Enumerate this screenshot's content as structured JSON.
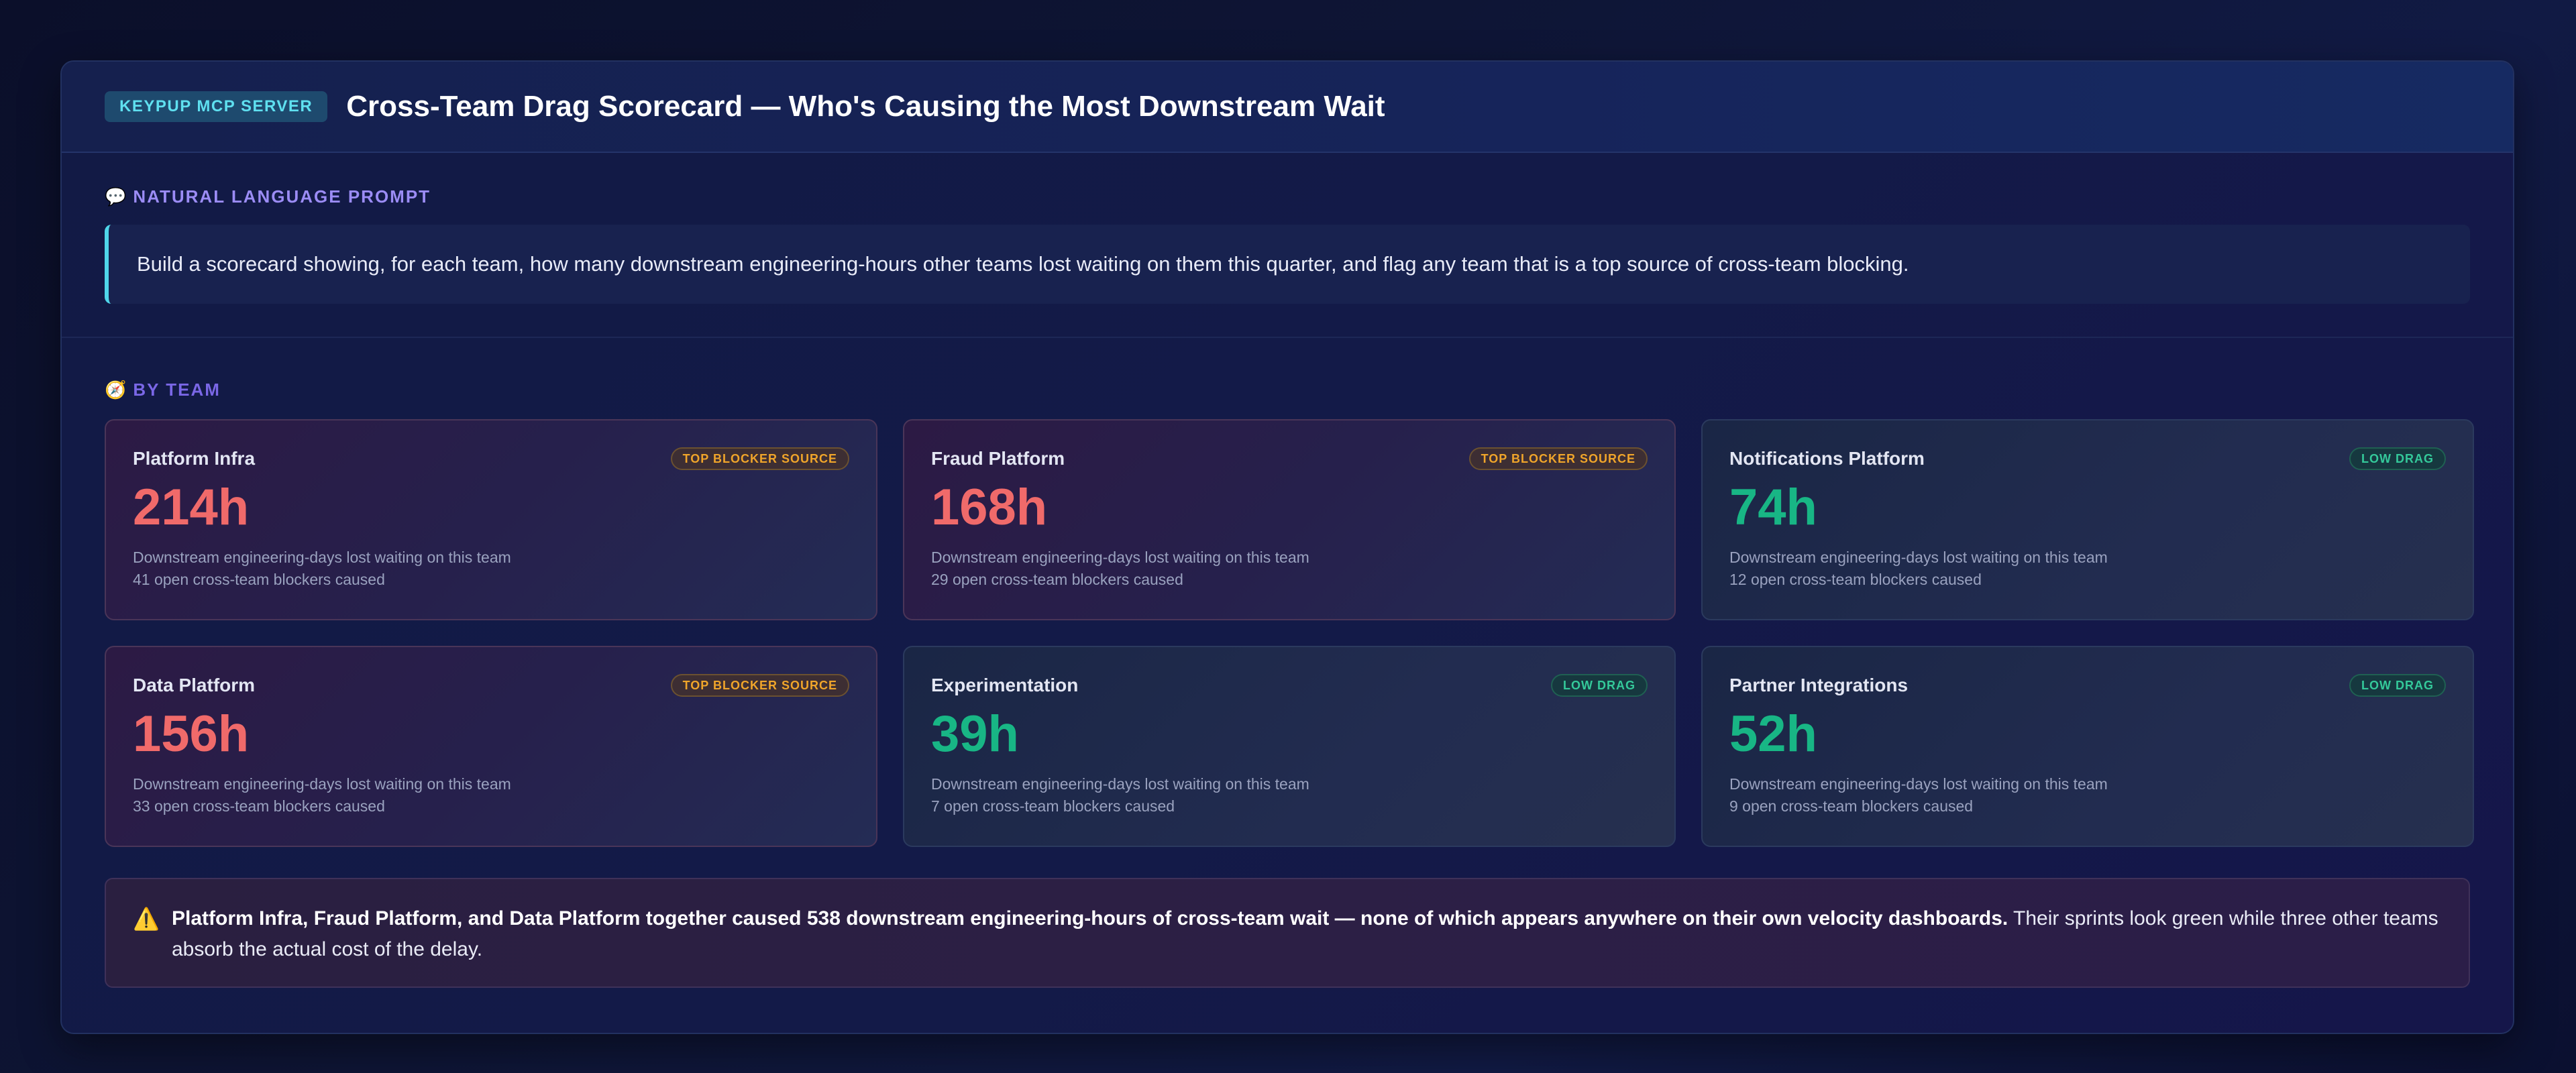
{
  "header": {
    "tag": "KEYPUP MCP SERVER",
    "title": "Cross-Team Drag Scorecard — Who's Causing the Most Downstream Wait"
  },
  "prompt": {
    "icon": "speech-bubble-icon",
    "label": "NATURAL LANGUAGE PROMPT",
    "text": "Build a scorecard showing, for each team, how many downstream engineering-hours other teams lost waiting on them this quarter, and flag any team that is a top source of cross-team blocking."
  },
  "by_team": {
    "icon": "compass-icon",
    "label": "BY TEAM",
    "teams": [
      {
        "name": "Platform Infra",
        "badge": "TOP BLOCKER SOURCE",
        "level": "high",
        "hours": "214h",
        "desc": "Downstream engineering-days lost waiting on this team",
        "blockers": "41 open cross-team blockers caused"
      },
      {
        "name": "Fraud Platform",
        "badge": "TOP BLOCKER SOURCE",
        "level": "high",
        "hours": "168h",
        "desc": "Downstream engineering-days lost waiting on this team",
        "blockers": "29 open cross-team blockers caused"
      },
      {
        "name": "Notifications Platform",
        "badge": "LOW DRAG",
        "level": "low",
        "hours": "74h",
        "desc": "Downstream engineering-days lost waiting on this team",
        "blockers": "12 open cross-team blockers caused"
      },
      {
        "name": "Data Platform",
        "badge": "TOP BLOCKER SOURCE",
        "level": "high",
        "hours": "156h",
        "desc": "Downstream engineering-days lost waiting on this team",
        "blockers": "33 open cross-team blockers caused"
      },
      {
        "name": "Experimentation",
        "badge": "LOW DRAG",
        "level": "low",
        "hours": "39h",
        "desc": "Downstream engineering-days lost waiting on this team",
        "blockers": "7 open cross-team blockers caused"
      },
      {
        "name": "Partner Integrations",
        "badge": "LOW DRAG",
        "level": "low",
        "hours": "52h",
        "desc": "Downstream engineering-days lost waiting on this team",
        "blockers": "9 open cross-team blockers caused"
      }
    ]
  },
  "callout": {
    "icon": "warning-icon",
    "bold": "Platform Infra, Fraud Platform, and Data Platform together caused 538 downstream engineering-hours of cross-team wait — none of which appears anywhere on their own velocity dashboards.",
    "rest": " Their sprints look green while three other teams absorb the actual cost of the delay."
  },
  "colors": {
    "high": "#f06a6a",
    "low": "#18b685",
    "high_badge": "#f0a52a",
    "low_badge": "#34c99a",
    "accent": "#4fd6ea"
  }
}
